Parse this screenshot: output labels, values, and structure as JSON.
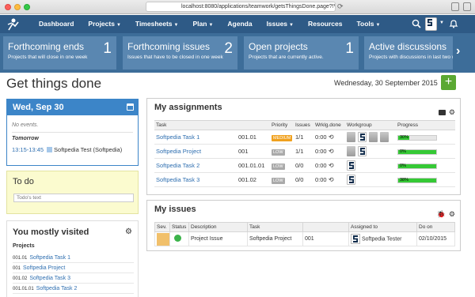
{
  "browser": {
    "url": "localhost:8080/applications/teamwork/getsThingsDone.page?!V_ID=473..."
  },
  "nav": {
    "items": [
      {
        "label": "Dashboard",
        "caret": false
      },
      {
        "label": "Projects",
        "caret": true
      },
      {
        "label": "Timesheets",
        "caret": true
      },
      {
        "label": "Plan",
        "caret": true
      },
      {
        "label": "Agenda",
        "caret": false
      },
      {
        "label": "Issues",
        "caret": true
      },
      {
        "label": "Resources",
        "caret": false
      },
      {
        "label": "Tools",
        "caret": true
      }
    ],
    "caret_glyph": "▼"
  },
  "cards": [
    {
      "title": "Forthcoming ends",
      "sub": "Projects that will close in one week",
      "count": "1"
    },
    {
      "title": "Forthcoming issues",
      "sub": "Issues that have to be closed in one week",
      "count": "2"
    },
    {
      "title": "Open projects",
      "sub": "Projects that are currently active.",
      "count": "1"
    },
    {
      "title": "Active discussions",
      "sub": "Projects with discussions in last two week",
      "count": ""
    }
  ],
  "page": {
    "title": "Get things done",
    "date": "Wednesday, 30 September 2015",
    "add_label": "+"
  },
  "calendar": {
    "header": "Wed, Sep 30",
    "no_events": "No events.",
    "tomorrow": "Tomorrow",
    "event_time": "13:15-13:45",
    "event_title": "Softpedia Test  (Softpedia)"
  },
  "todo": {
    "title": "To do",
    "placeholder": "Todo's text"
  },
  "visited": {
    "title": "You mostly visited",
    "section": "Projects",
    "items": [
      {
        "code": "001.01",
        "label": "Softpedia Task 1"
      },
      {
        "code": "001",
        "label": "Softpedia Project"
      },
      {
        "code": "001.02",
        "label": "Softpedia Task 3"
      },
      {
        "code": "001.01.01",
        "label": "Softpedia Task 2"
      }
    ]
  },
  "assignments": {
    "title": "My assignments",
    "columns": [
      "Task",
      "",
      "Priority",
      "Issues",
      "Wrklg.done",
      "Workgroup",
      "Progress"
    ],
    "rows": [
      {
        "task": "Softpedia Task 1",
        "code": "001.01",
        "priority": "MEDIUM",
        "issues": "1/1",
        "worklog": "0:00",
        "progress": 30,
        "progress_label": "30%"
      },
      {
        "task": "Softpedia Project",
        "code": "001",
        "priority": "LOW",
        "issues": "1/1",
        "worklog": "0:00",
        "progress": 100,
        "progress_label": "0%"
      },
      {
        "task": "Softpedia Task 2",
        "code": "001.01.01",
        "priority": "LOW",
        "issues": "0/0",
        "worklog": "0:00",
        "progress": 100,
        "progress_label": "0%"
      },
      {
        "task": "Softpedia Task 3",
        "code": "001.02",
        "priority": "LOW",
        "issues": "0/0",
        "worklog": "0:00",
        "progress": 100,
        "progress_label": "38%"
      }
    ]
  },
  "issues": {
    "title": "My issues",
    "columns": [
      "Sev.",
      "Status",
      "Description",
      "Task",
      "",
      "Assigned to",
      "Do on"
    ],
    "rows": [
      {
        "description": "Project Issue",
        "task": "Softpedia Project",
        "code": "001",
        "assigned": "Softpedia Tester",
        "do_on": "02/10/2015"
      }
    ]
  },
  "colors": {
    "nav": "#2e5a86",
    "carousel": "#3d6d99",
    "card": "#5a87b1",
    "accent_blue": "#3c85c8",
    "add_green": "#5aa832",
    "progress_green": "#35c935",
    "priority_medium": "#f0a11e",
    "priority_low": "#aaaaaa",
    "severity": "#f1c06b",
    "status_green": "#3bb34a"
  }
}
